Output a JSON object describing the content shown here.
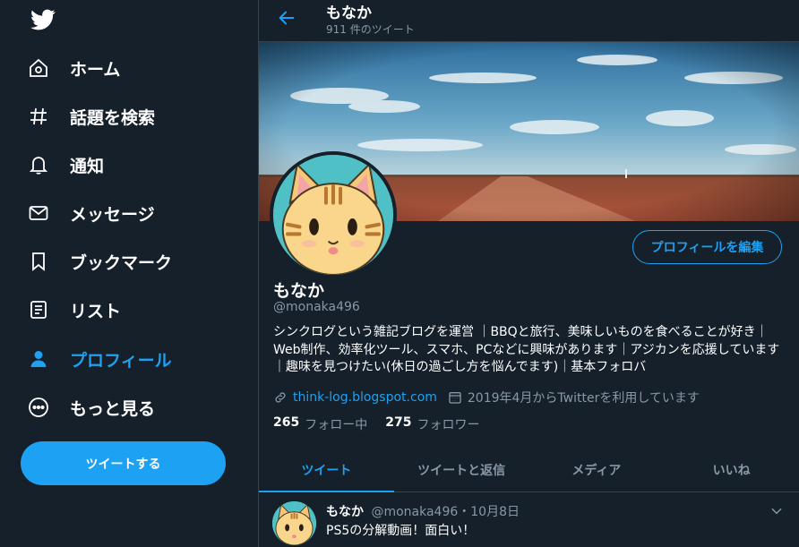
{
  "sidebar": {
    "logo": "twitter-bird-icon",
    "items": [
      {
        "label": "ホーム",
        "icon": "home-icon"
      },
      {
        "label": "話題を検索",
        "icon": "hashtag-icon"
      },
      {
        "label": "通知",
        "icon": "bell-icon"
      },
      {
        "label": "メッセージ",
        "icon": "envelope-icon"
      },
      {
        "label": "ブックマーク",
        "icon": "bookmark-icon"
      },
      {
        "label": "リスト",
        "icon": "list-icon"
      },
      {
        "label": "プロフィール",
        "icon": "person-icon",
        "active": true
      },
      {
        "label": "もっと見る",
        "icon": "more-icon"
      }
    ],
    "tweet_button": "ツイートする"
  },
  "header": {
    "name": "もなか",
    "tweet_count": "911 件のツイート"
  },
  "profile": {
    "edit_button": "プロフィールを編集",
    "name": "もなか",
    "handle": "@monaka496",
    "bio": "シンクログという雑記ブログを運営 ｜BBQと旅行、美味しいものを食べることが好き｜Web制作、効率化ツール、スマホ、PCなどに興味があります｜アジカンを応援しています｜趣味を見つけたい(休日の過ごし方を悩んでます)｜基本フォロバ",
    "link": "think-log.blogspot.com",
    "joined": "2019年4月からTwitterを利用しています",
    "following_count": "265",
    "following_label": "フォロー中",
    "followers_count": "275",
    "followers_label": "フォロワー"
  },
  "tabs": [
    "ツイート",
    "ツイートと返信",
    "メディア",
    "いいね"
  ],
  "tweet": {
    "name": "もなか",
    "meta": "@monaka496・10月8日",
    "text": "PS5の分解動画！面白い！"
  },
  "colors": {
    "background": "#15202b",
    "accent": "#1da1f2",
    "muted": "#8899a6",
    "border": "#38444d"
  }
}
